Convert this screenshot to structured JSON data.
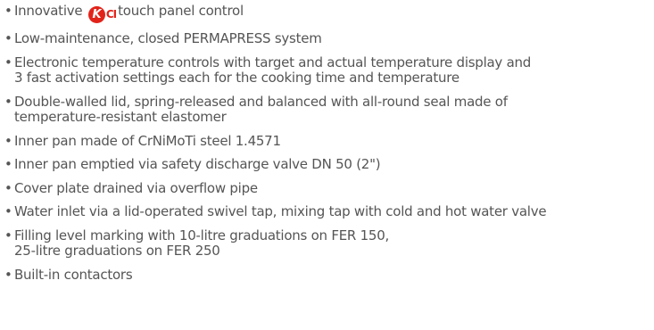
{
  "features": [
    {
      "before_logo": "Innovative",
      "logo_name": "KCI",
      "after_logo": "touch panel control"
    },
    {
      "lines": [
        "Low-maintenance, closed PERMAPRESS system"
      ]
    },
    {
      "lines": [
        "Electronic temperature controls with target and actual temperature display and",
        "3 fast activation settings each for the cooking time and temperature"
      ]
    },
    {
      "lines": [
        "Double-walled lid, spring-released and balanced with all-round seal made of",
        "temperature-resistant elastomer"
      ]
    },
    {
      "lines": [
        "Inner pan made of CrNiMoTi steel 1.4571"
      ]
    },
    {
      "lines": [
        "Inner pan emptied via safety discharge valve DN 50 (2\")"
      ]
    },
    {
      "lines": [
        "Cover plate drained via overflow pipe"
      ]
    },
    {
      "lines": [
        "Water inlet via a lid-operated swivel tap, mixing tap with cold and hot water valve"
      ]
    },
    {
      "lines": [
        "Filling level marking with 10-litre graduations on FER 150,",
        "25-litre graduations on FER 250"
      ]
    },
    {
      "lines": [
        "Built-in contactors"
      ]
    }
  ],
  "colors": {
    "text": "#555555",
    "logo_red": "#e2231a"
  }
}
